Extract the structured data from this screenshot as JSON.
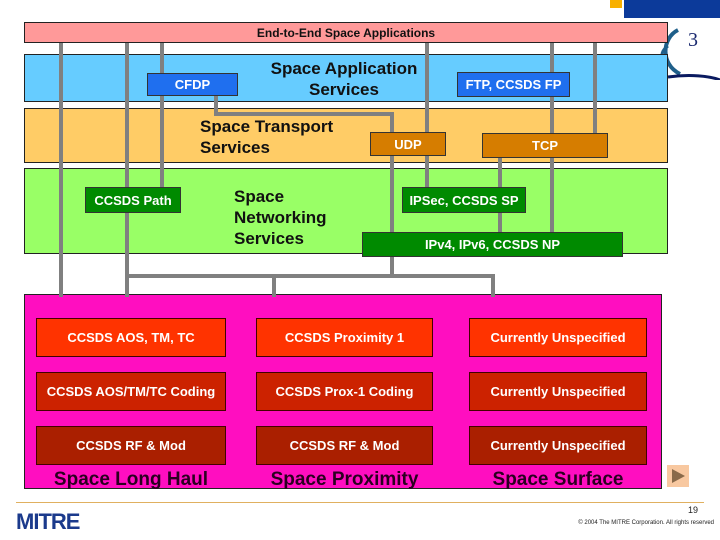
{
  "slide": {
    "page_number": "19",
    "copyright": "© 2004 The MITRE Corporation. All rights reserved",
    "logo_text": "MITRE"
  },
  "layers": {
    "end_to_end": {
      "label": "End-to-End Space Applications",
      "color": "#ff9999"
    },
    "application": {
      "title": "Space Application Services",
      "title_line1": "Space Application",
      "title_line2": "Services",
      "color": "#66ccff",
      "boxes": [
        {
          "label": "CFDP"
        },
        {
          "label": "FTP, CCSDS FP"
        }
      ]
    },
    "transport": {
      "title_line1": "Space Transport",
      "title_line2": "Services",
      "color": "#ffcc66",
      "boxes": [
        {
          "label": "UDP"
        },
        {
          "label": "TCP"
        }
      ]
    },
    "networking": {
      "title_line1": "Space",
      "title_line2": "Networking",
      "title_line3": "Services",
      "color": "#99ff66",
      "boxes": [
        {
          "label": "CCSDS Path"
        },
        {
          "label": "IPSec, CCSDS SP"
        },
        {
          "label": "IPv4, IPv6, CCSDS NP"
        }
      ]
    },
    "link": {
      "color": "#ff0ec0",
      "columns": [
        {
          "environment": "Space Long Haul",
          "rows": [
            "CCSDS AOS, TM, TC",
            "CCSDS AOS/TM/TC Coding",
            "CCSDS RF & Mod"
          ]
        },
        {
          "environment": "Space Proximity",
          "rows": [
            "CCSDS Proximity 1",
            "CCSDS Prox-1 Coding",
            "CCSDS RF & Mod"
          ]
        },
        {
          "environment": "Space Surface",
          "rows": [
            "Currently Unspecified",
            "Currently Unspecified",
            "Currently Unspecified"
          ]
        }
      ]
    }
  },
  "icons": {
    "next": "next-slide-arrow-icon",
    "corner_logo": "ccsds-logo-icon"
  }
}
